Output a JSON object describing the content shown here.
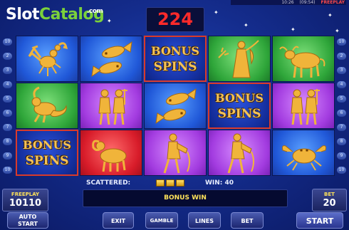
{
  "logo": {
    "slot": "Slot",
    "catalog": "Catalog",
    "com": ".com"
  },
  "top_bar": {
    "time": "10:26",
    "clock": "(09:54)",
    "freeplay": "FREEPLAY"
  },
  "win_display": "224",
  "line_numbers_left": [
    "10",
    "2",
    "3",
    "4",
    "5",
    "6",
    "7",
    "8",
    "9",
    "10"
  ],
  "line_numbers_right": [
    "10",
    "2",
    "3",
    "4",
    "5",
    "6",
    "7",
    "8",
    "9",
    "10"
  ],
  "reels": [
    [
      "scorpio",
      "capricorn",
      "bonus"
    ],
    [
      "pisces",
      "gemini",
      "aries"
    ],
    [
      "bonus",
      "pisces",
      "aquarius"
    ],
    [
      "virgo",
      "bonus",
      "aquarius"
    ],
    [
      "taurus",
      "gemini",
      "cancer"
    ]
  ],
  "bonus_symbol": {
    "line1": "BONUS",
    "line2": "SPINS"
  },
  "scattered_label": "SCATTERED:",
  "scattered_count": 3,
  "win_label": "WIN: 40",
  "message": "BONUS WIN",
  "freeplay_panel": {
    "title": "FREEPLAY",
    "value": "10110"
  },
  "bet_panel": {
    "title": "BET",
    "value": "20"
  },
  "buttons": {
    "auto_start_line1": "AUTO",
    "auto_start_line2": "START",
    "exit": "EXIT",
    "gamble": "GAMBLE",
    "lines": "LINES",
    "bet": "BET",
    "start": "START"
  },
  "colors": {
    "win_red": "#ff2a2a",
    "gold": "#f2c25a",
    "message_yellow": "#ffe35a"
  }
}
